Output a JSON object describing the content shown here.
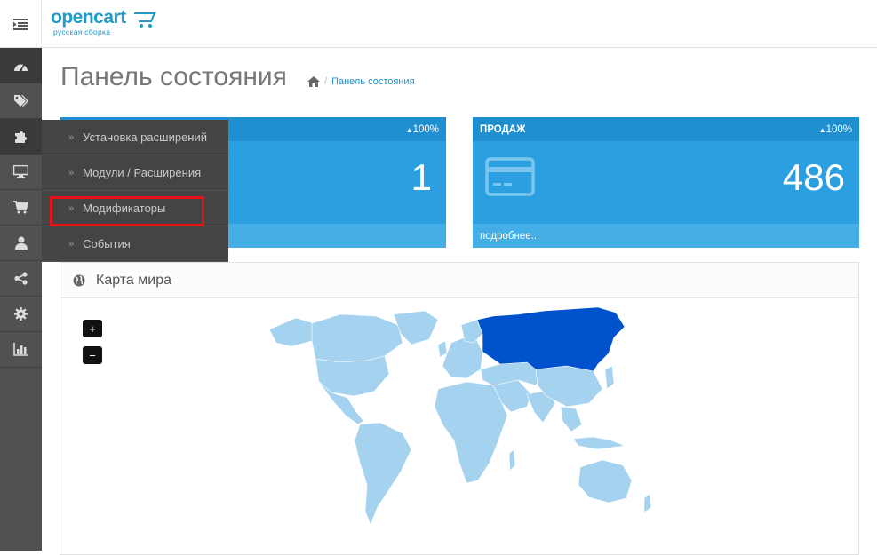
{
  "header": {
    "logo_brand": "opencart",
    "logo_sub": "русская сборка"
  },
  "sidebar": {
    "icons": [
      "dashboard-icon",
      "tags-icon",
      "puzzle-icon",
      "desktop-icon",
      "cart-icon",
      "user-icon",
      "share-icon",
      "cog-icon",
      "bar-chart-icon"
    ]
  },
  "flyout": {
    "items": [
      {
        "label": "Установка расширений"
      },
      {
        "label": "Модули / Расширения"
      },
      {
        "label": "Модификаторы"
      },
      {
        "label": "События"
      }
    ]
  },
  "page": {
    "title": "Панель состояния",
    "breadcrumb": "Панель состояния"
  },
  "tiles": [
    {
      "title": "",
      "percent": "100%",
      "value": "1",
      "footer": ""
    },
    {
      "title": "ПРОДАЖ",
      "percent": "100%",
      "value": "486",
      "footer": "подробнее..."
    }
  ],
  "map_panel": {
    "title": "Карта мира",
    "zoom_in": "+",
    "zoom_out": "−"
  },
  "colors": {
    "tile_bg": "#2b9fe0",
    "map_land": "#a4d2ef",
    "map_highlight": "#0052cc"
  }
}
